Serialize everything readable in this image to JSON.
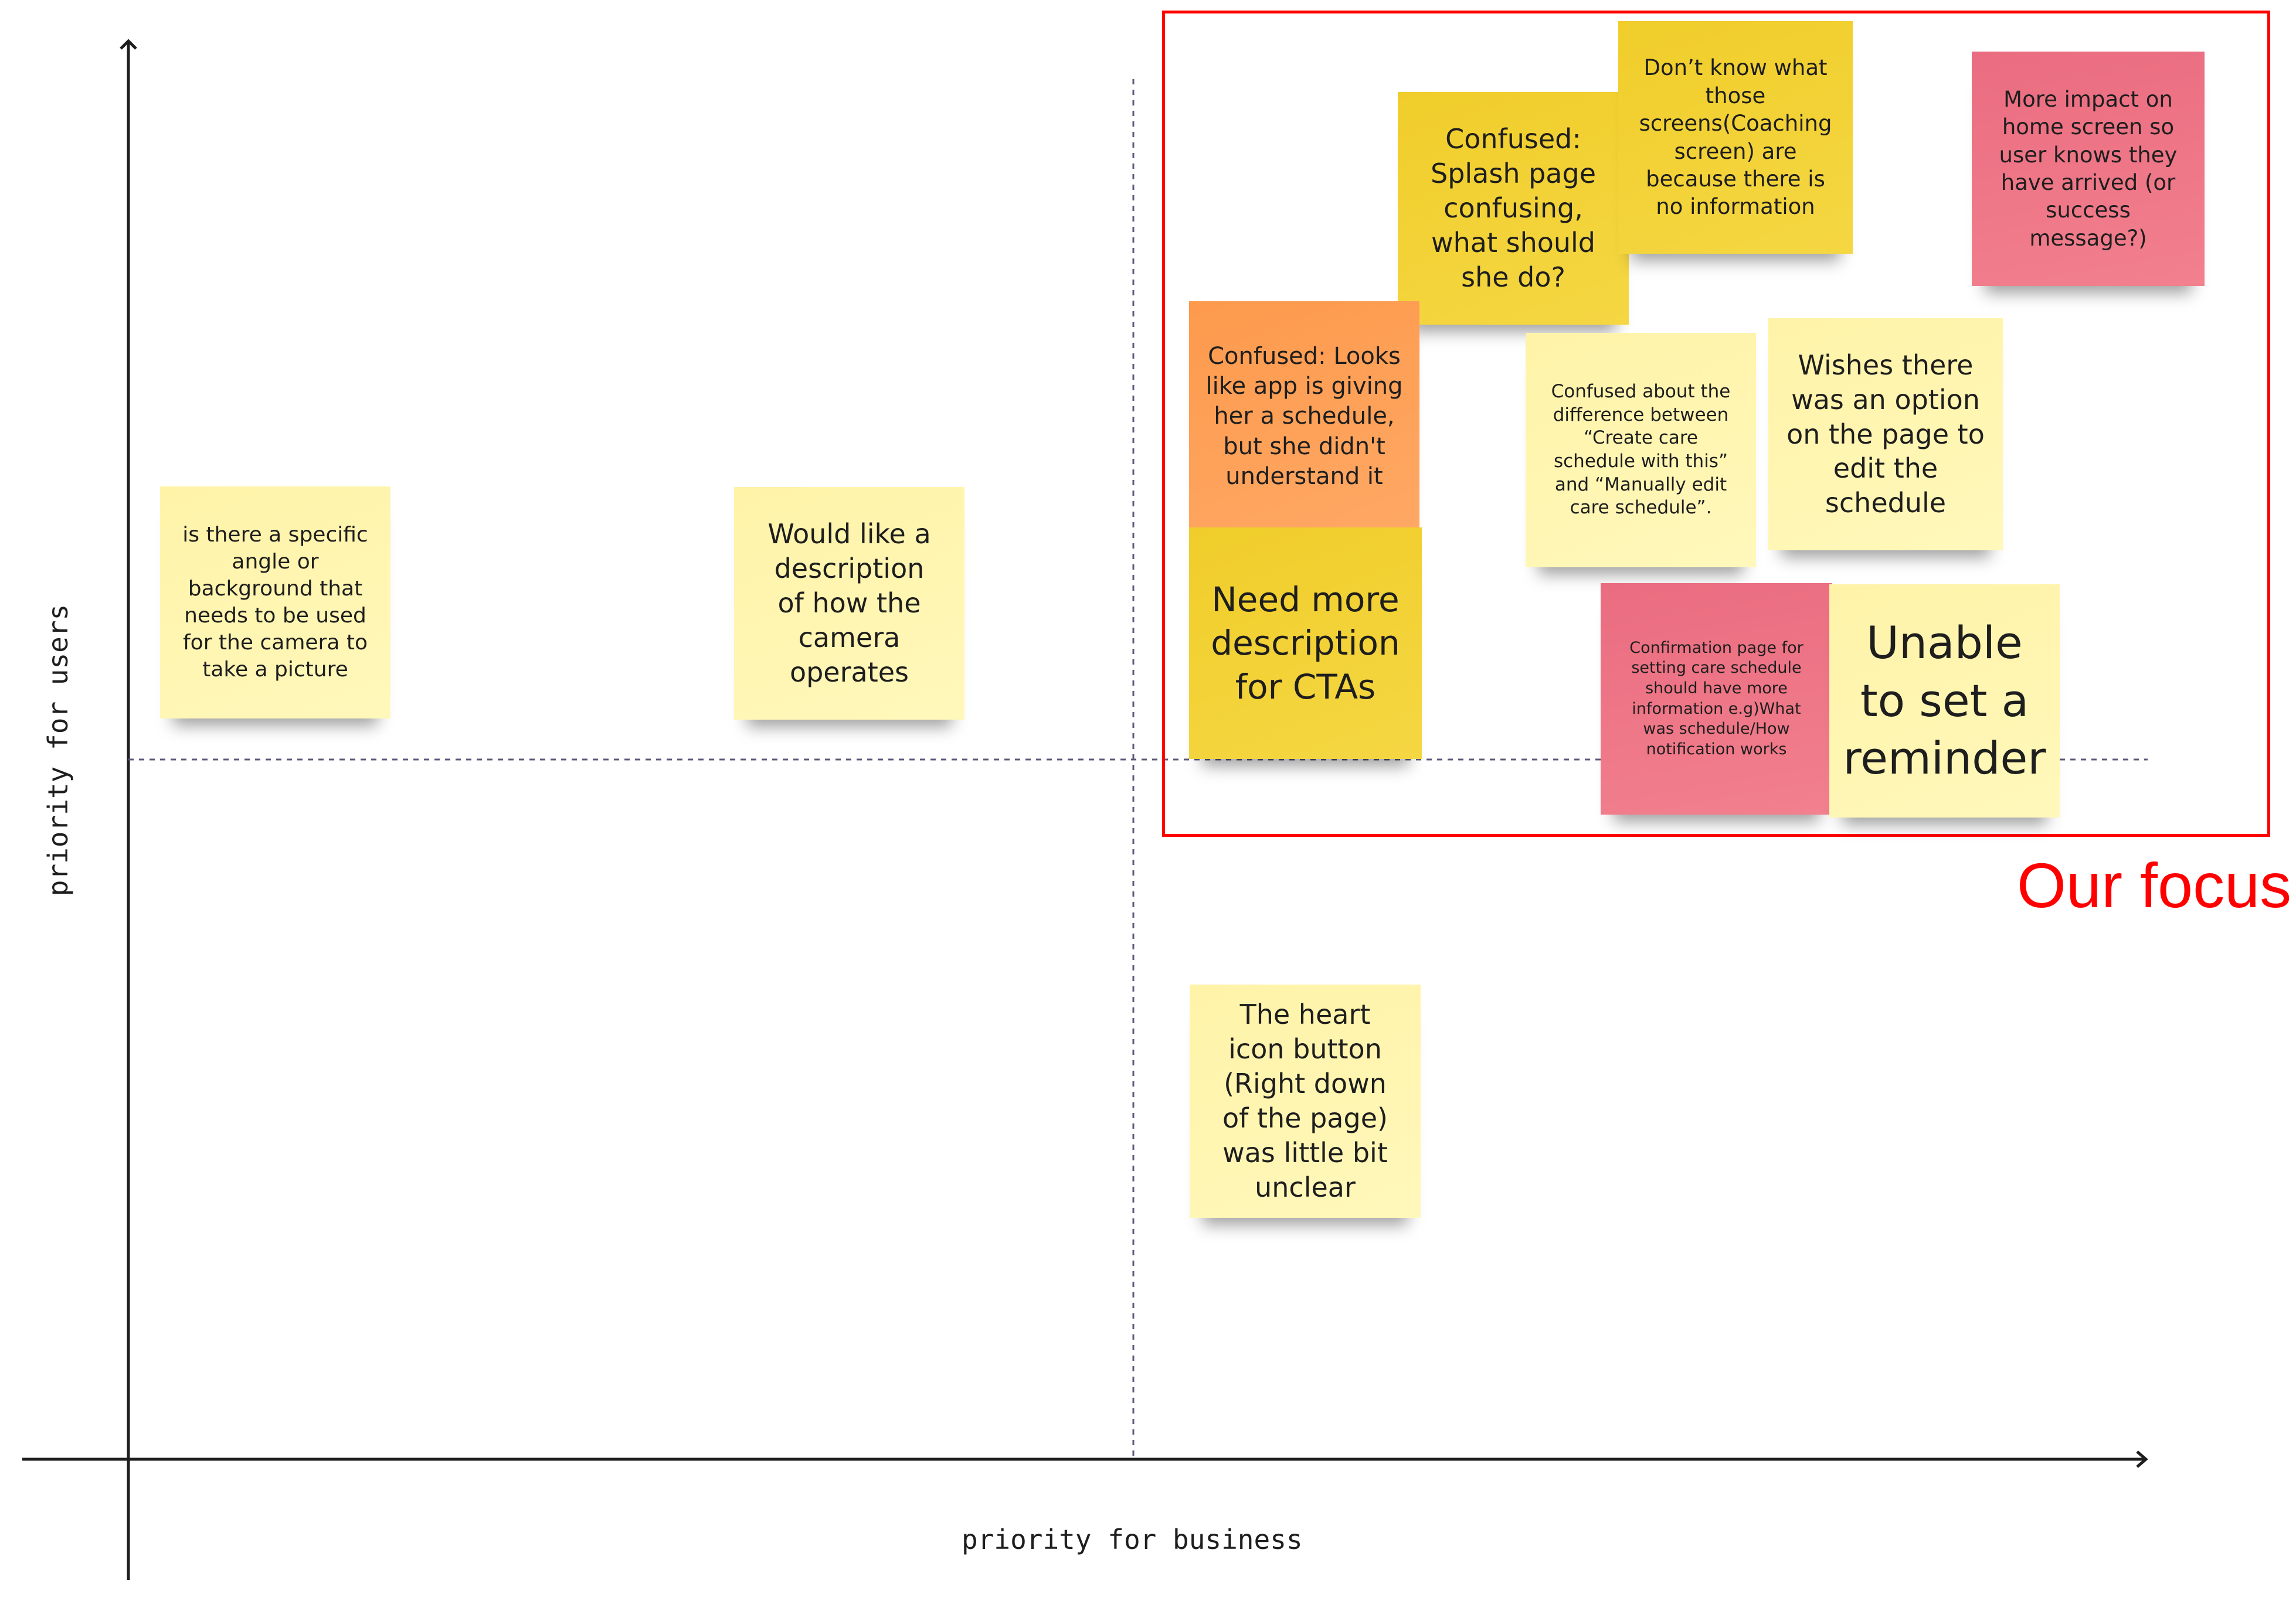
{
  "matrix": {
    "x_axis_label": "priority for business",
    "y_axis_label": "priority for users",
    "focus_label": "Our focus",
    "focus_color": "#ff0000"
  },
  "colors": {
    "light_yellow": "#fff6b0",
    "yellow": "#f2d134",
    "orange": "#fda35a",
    "pink": "#ef7385",
    "axis": "#1e1e1e",
    "divider": "#5b5a7a"
  },
  "stickies": [
    {
      "id": "s1",
      "quadrant": "top-left",
      "color": "light_yellow",
      "text": "is there a specific angle or background that needs to be used for the camera to take a picture"
    },
    {
      "id": "s2",
      "quadrant": "top-left",
      "color": "light_yellow",
      "text": "Would like a description of how the camera operates"
    },
    {
      "id": "s3",
      "quadrant": "top-right",
      "color": "yellow",
      "text": "Confused: Splash page confusing, what should she do?"
    },
    {
      "id": "s4",
      "quadrant": "top-right",
      "color": "yellow",
      "text": "Don’t know what those screens(Coaching screen) are because there is no information"
    },
    {
      "id": "s5",
      "quadrant": "top-right",
      "color": "pink",
      "text": "More impact on home screen so user knows they have arrived (or success message?)"
    },
    {
      "id": "s6",
      "quadrant": "top-right",
      "color": "orange",
      "text": "Confused: Looks like app is giving her a schedule, but she didn't understand it"
    },
    {
      "id": "s7",
      "quadrant": "top-right",
      "color": "light_yellow",
      "text": "Confused about the difference between “Create care schedule with this” and “Manually edit care schedule”."
    },
    {
      "id": "s8",
      "quadrant": "top-right",
      "color": "light_yellow",
      "text": "Wishes there was an option on the page to edit the schedule"
    },
    {
      "id": "s9",
      "quadrant": "top-right",
      "color": "yellow",
      "text": "Need more description for CTAs"
    },
    {
      "id": "s10",
      "quadrant": "top-right",
      "color": "pink",
      "text": "Confirmation page for setting care schedule should have more information e.g)What was schedule/How notification works"
    },
    {
      "id": "s11",
      "quadrant": "top-right",
      "color": "light_yellow",
      "text": "Unable to set a reminder"
    },
    {
      "id": "s12",
      "quadrant": "bottom-right",
      "color": "light_yellow",
      "text": "The heart icon button (Right down of the page) was little bit unclear"
    }
  ]
}
